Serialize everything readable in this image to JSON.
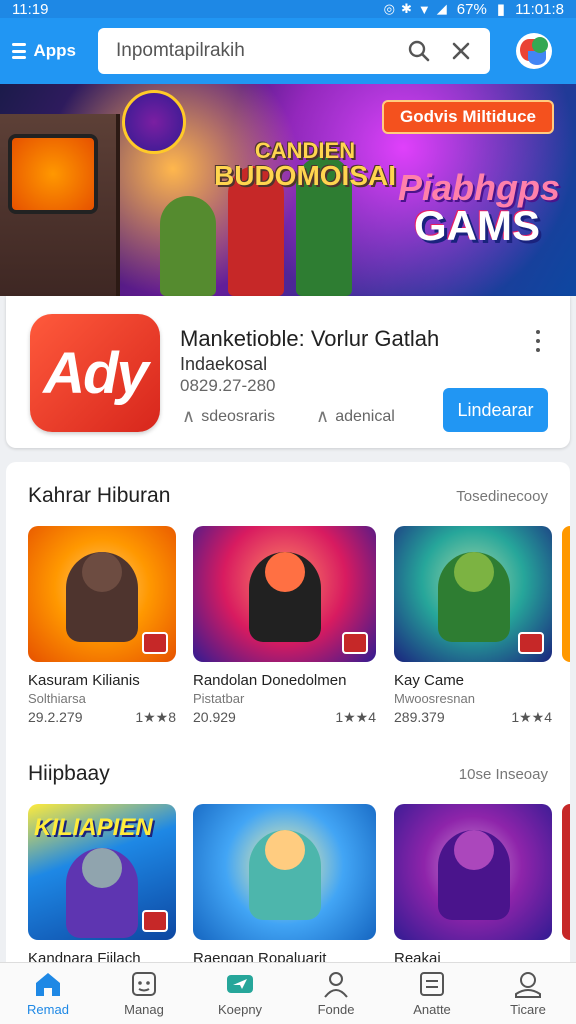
{
  "status_bar": {
    "time": "11:19",
    "battery": "67%",
    "clock_right": "11:01:8"
  },
  "app_bar": {
    "menu_label": "Apps",
    "search": {
      "value": "Inpomtapilrakih"
    },
    "logo": "store-logo"
  },
  "banner": {
    "pill": "Godvis Miltiduce",
    "title_line1": "CANDIEN",
    "title_line2": "BUDOMOISAI",
    "subtitle": "Piabhgps",
    "word": "GAMS"
  },
  "featured_app": {
    "icon_text": "Ady",
    "title": "Manketioble: Vorlur Gatlah",
    "developer": "Indaekosal",
    "count": "0829.27-280",
    "meta1": "sdeosraris",
    "meta2": "adenical",
    "install_label": "Lindearar"
  },
  "sections": [
    {
      "title": "Kahrar Hiburan",
      "more": "Tosedinecooy",
      "items": [
        {
          "name": "Kasuram Kilianis",
          "sub": "Solthiarsa",
          "count": "29.2.279",
          "rating": "1★★8"
        },
        {
          "name": "Randolan Donedolmen",
          "sub": "Pistatbar",
          "count": "20.929",
          "rating": "1★★4"
        },
        {
          "name": "Kay Came",
          "sub": "Mwoosresnan",
          "count": "289.379",
          "rating": "1★★4"
        }
      ]
    },
    {
      "title": "Hiipbaay",
      "more": "10se Inseoay",
      "items": [
        {
          "name": "Kandnara Fiilach",
          "badge_word": "KILIAPIEN"
        },
        {
          "name": "Raengan Ropaluarit"
        },
        {
          "name": "Reakai"
        }
      ]
    }
  ],
  "bottom_nav": [
    {
      "label": "Remad",
      "icon": "home-icon",
      "active": true
    },
    {
      "label": "Manag",
      "icon": "game-icon",
      "active": false
    },
    {
      "label": "Koepny",
      "icon": "plane-icon",
      "active": false
    },
    {
      "label": "Fonde",
      "icon": "person-icon",
      "active": false
    },
    {
      "label": "Anatte",
      "icon": "list-icon",
      "active": false
    },
    {
      "label": "Ticare",
      "icon": "account-icon",
      "active": false
    }
  ],
  "colors": {
    "primary": "#2196f3",
    "install": "#2196f3",
    "active_nav": "#1e88e5"
  }
}
